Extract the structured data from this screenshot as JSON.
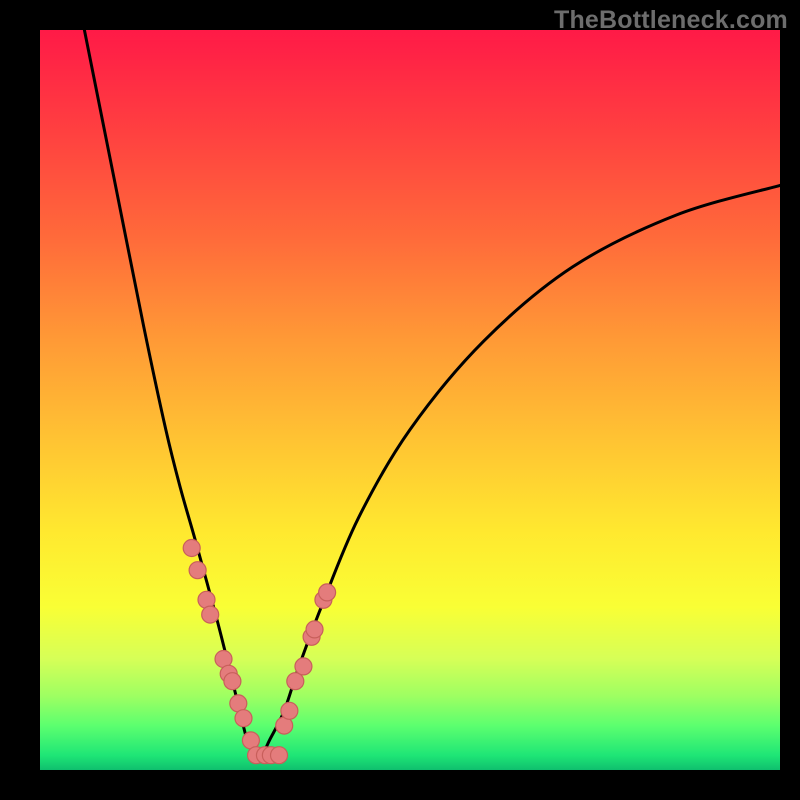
{
  "watermark": "TheBottleneck.com",
  "colors": {
    "gradient_top": "#ff1a47",
    "gradient_bottom": "#0fbf6e",
    "marker_fill": "#e47c7c",
    "marker_stroke": "#c85f5b",
    "curve_stroke": "#000000",
    "frame_bg": "#000000"
  },
  "chart_data": {
    "type": "line",
    "title": "",
    "xlabel": "",
    "ylabel": "",
    "xlim": [
      0,
      100
    ],
    "ylim": [
      0,
      100
    ],
    "grid": false,
    "legend": false,
    "series": [
      {
        "name": "bottleneck-curve",
        "x": [
          6,
          10,
          14,
          17,
          19,
          21,
          24,
          26,
          27,
          28,
          29,
          30,
          31,
          33,
          35,
          38,
          43,
          50,
          60,
          72,
          86,
          100
        ],
        "values": [
          100,
          80,
          60,
          46,
          38,
          31,
          20,
          12,
          8,
          4,
          2,
          2,
          4,
          8,
          14,
          22,
          34,
          46,
          58,
          68,
          75,
          79
        ]
      }
    ],
    "markers": [
      {
        "x": 20.5,
        "y": 30
      },
      {
        "x": 21.3,
        "y": 27
      },
      {
        "x": 22.5,
        "y": 23
      },
      {
        "x": 23.0,
        "y": 21
      },
      {
        "x": 24.8,
        "y": 15
      },
      {
        "x": 25.5,
        "y": 13
      },
      {
        "x": 26.0,
        "y": 12
      },
      {
        "x": 26.8,
        "y": 9
      },
      {
        "x": 27.5,
        "y": 7
      },
      {
        "x": 28.5,
        "y": 4
      },
      {
        "x": 29.2,
        "y": 2
      },
      {
        "x": 30.4,
        "y": 2
      },
      {
        "x": 31.2,
        "y": 2
      },
      {
        "x": 32.3,
        "y": 2
      },
      {
        "x": 33.0,
        "y": 6
      },
      {
        "x": 33.7,
        "y": 8
      },
      {
        "x": 34.5,
        "y": 12
      },
      {
        "x": 35.6,
        "y": 14
      },
      {
        "x": 36.7,
        "y": 18
      },
      {
        "x": 37.1,
        "y": 19
      },
      {
        "x": 38.3,
        "y": 23
      },
      {
        "x": 38.8,
        "y": 24
      }
    ],
    "marker_radius": 8.5
  }
}
